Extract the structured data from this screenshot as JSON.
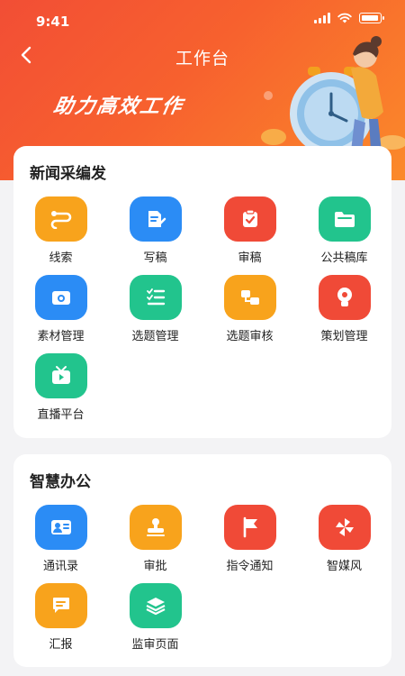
{
  "status_bar": {
    "time": "9:41"
  },
  "nav": {
    "title": "工作台"
  },
  "hero": {
    "slogan": "助力高效工作"
  },
  "sections": [
    {
      "title": "新闻采编发",
      "items": [
        {
          "label": "线索",
          "icon": "clue-icon",
          "color": "#f8a31c"
        },
        {
          "label": "写稿",
          "icon": "write-icon",
          "color": "#2b8cf5"
        },
        {
          "label": "审稿",
          "icon": "review-icon",
          "color": "#f04a37"
        },
        {
          "label": "公共稿库",
          "icon": "folder-icon",
          "color": "#22c48d"
        },
        {
          "label": "素材管理",
          "icon": "material-icon",
          "color": "#2b8cf5"
        },
        {
          "label": "选题管理",
          "icon": "list-icon",
          "color": "#22c48d"
        },
        {
          "label": "选题审核",
          "icon": "topic-review-icon",
          "color": "#f8a31c"
        },
        {
          "label": "策划管理",
          "icon": "bulb-icon",
          "color": "#f04a37"
        },
        {
          "label": "直播平台",
          "icon": "tv-icon",
          "color": "#22c48d"
        }
      ]
    },
    {
      "title": "智慧办公",
      "items": [
        {
          "label": "通讯录",
          "icon": "contacts-icon",
          "color": "#2b8cf5"
        },
        {
          "label": "审批",
          "icon": "stamp-icon",
          "color": "#f8a31c"
        },
        {
          "label": "指令通知",
          "icon": "flag-icon",
          "color": "#f04a37"
        },
        {
          "label": "智媒风",
          "icon": "pinwheel-icon",
          "color": "#f04a37"
        },
        {
          "label": "汇报",
          "icon": "report-icon",
          "color": "#f8a31c"
        },
        {
          "label": "监审页面",
          "icon": "layers-icon",
          "color": "#22c48d"
        }
      ]
    }
  ]
}
